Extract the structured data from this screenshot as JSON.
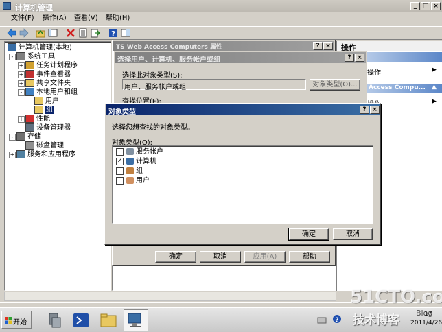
{
  "main_window": {
    "title": "计算机管理",
    "menu": [
      "文件(F)",
      "操作(A)",
      "查看(V)",
      "帮助(H)"
    ],
    "tree": [
      {
        "label": "计算机管理(本地)",
        "level": 0,
        "icon": "computer-icon",
        "expander": ""
      },
      {
        "label": "系统工具",
        "level": 1,
        "icon": "tools-icon",
        "expander": "-"
      },
      {
        "label": "任务计划程序",
        "level": 2,
        "icon": "clock-icon",
        "expander": "+"
      },
      {
        "label": "事件查看器",
        "level": 2,
        "icon": "event-icon",
        "expander": "+"
      },
      {
        "label": "共享文件夹",
        "level": 2,
        "icon": "share-icon",
        "expander": "+"
      },
      {
        "label": "本地用户和组",
        "level": 2,
        "icon": "users-icon",
        "expander": "-"
      },
      {
        "label": "用户",
        "level": 3,
        "icon": "folder-icon",
        "expander": ""
      },
      {
        "label": "组",
        "level": 3,
        "icon": "folder-icon",
        "expander": "",
        "selected": true
      },
      {
        "label": "性能",
        "level": 2,
        "icon": "perf-icon",
        "expander": "+"
      },
      {
        "label": "设备管理器",
        "level": 2,
        "icon": "device-icon",
        "expander": ""
      },
      {
        "label": "存储",
        "level": 1,
        "icon": "storage-icon",
        "expander": "-"
      },
      {
        "label": "磁盘管理",
        "level": 2,
        "icon": "disk-icon",
        "expander": ""
      },
      {
        "label": "服务和应用程序",
        "level": 1,
        "icon": "services-icon",
        "expander": "+"
      }
    ],
    "actions_pane": {
      "header": "操作",
      "item1": "操作",
      "section2": "Access Compu...",
      "item2": "操作"
    }
  },
  "props_window": {
    "title": "TS Web Access Computers 属性",
    "buttons": [
      "确定",
      "取消",
      "应用(A)",
      "帮助"
    ]
  },
  "select_dialog": {
    "title": "选择用户、计算机、服务帐户或组",
    "object_type_label": "选择此对象类型(S):",
    "object_type_value": "用户、服务帐户或组",
    "object_type_button": "对象类型(O)...",
    "location_label": "查找位置(F):"
  },
  "object_types_dialog": {
    "title": "对象类型",
    "instruction": "选择您想查找的对象类型。",
    "list_label": "对象类型(O):",
    "items": [
      {
        "label": "服务帐户",
        "checked": false,
        "icon": "service-account-icon"
      },
      {
        "label": "计算机",
        "checked": true,
        "icon": "computer-icon"
      },
      {
        "label": "组",
        "checked": false,
        "icon": "group-icon"
      },
      {
        "label": "用户",
        "checked": false,
        "icon": "user-icon"
      }
    ],
    "ok": "确定",
    "cancel": "取消"
  },
  "taskbar": {
    "start": "开始",
    "clock_time": "17",
    "clock_date": "2011/4/26"
  },
  "watermark": {
    "site": "51CTO.com",
    "tagline": "技术博客",
    "suffix": "Blog"
  },
  "colors": {
    "title_active": "#0a246a",
    "selection": "#0a246a",
    "desktop": "#d4d0c8",
    "taskbar": "#dcdcdc"
  }
}
